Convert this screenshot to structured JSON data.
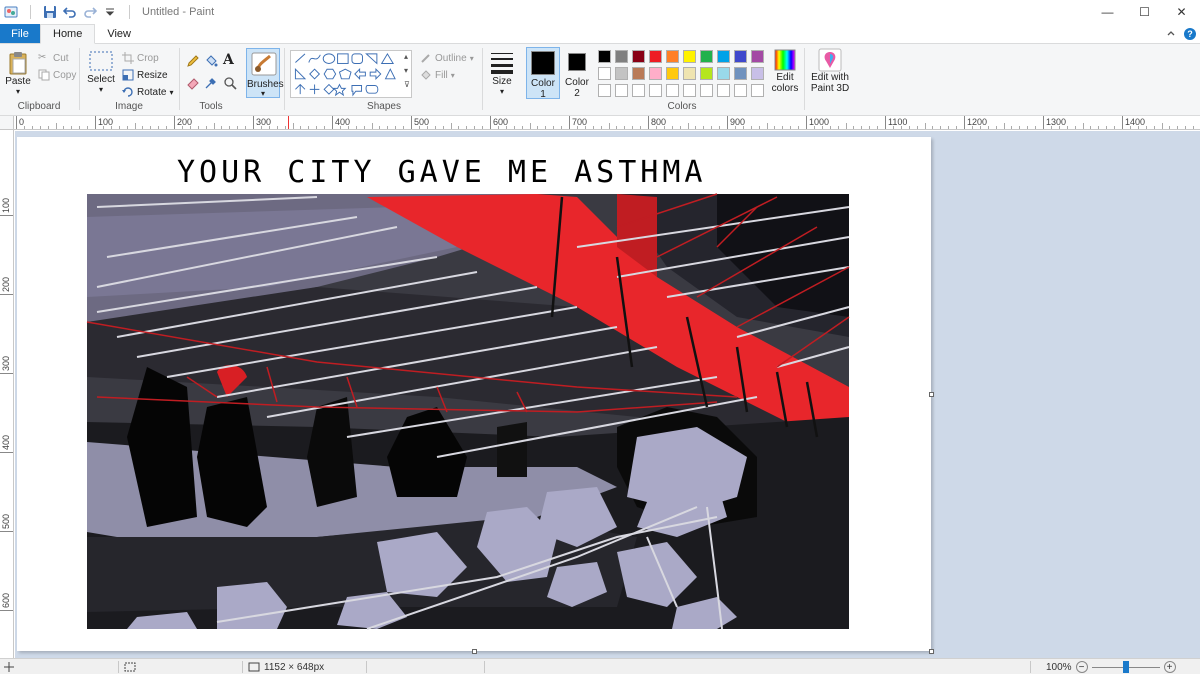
{
  "window": {
    "title": "Untitled - Paint",
    "controls": {
      "minimize": "—",
      "maximize": "☐",
      "close": "✕"
    }
  },
  "tabs": {
    "file": "File",
    "home": "Home",
    "view": "View"
  },
  "ribbon": {
    "clipboard": {
      "paste": "Paste",
      "cut": "Cut",
      "copy": "Copy",
      "label": "Clipboard"
    },
    "image": {
      "select": "Select",
      "crop": "Crop",
      "resize": "Resize",
      "rotate": "Rotate",
      "label": "Image"
    },
    "tools": {
      "label": "Tools",
      "text_tool": "A"
    },
    "brushes": {
      "label": "Brushes"
    },
    "shapes": {
      "outline": "Outline",
      "fill": "Fill",
      "label": "Shapes"
    },
    "size": {
      "label": "Size"
    },
    "color1": {
      "label": "Color",
      "num": "1",
      "value": "#000000"
    },
    "color2": {
      "label": "Color",
      "num": "2",
      "value": "#ffffff"
    },
    "colors": {
      "label": "Colors",
      "row1": [
        "#000000",
        "#7f7f7f",
        "#880015",
        "#ed1c24",
        "#ff7f27",
        "#fff200",
        "#22b14c",
        "#00a2e8",
        "#3f48cc",
        "#a349a4"
      ],
      "row2": [
        "#ffffff",
        "#c3c3c3",
        "#b97a57",
        "#ffaec9",
        "#ffc90e",
        "#efe4b0",
        "#b5e61d",
        "#99d9ea",
        "#7092be",
        "#c8bfe7"
      ],
      "row3": [
        "#ffffff",
        "#ffffff",
        "#ffffff",
        "#ffffff",
        "#ffffff",
        "#ffffff",
        "#ffffff",
        "#ffffff",
        "#ffffff",
        "#ffffff"
      ],
      "edit_line1": "Edit",
      "edit_line2": "colors",
      "paint3d_line1": "Edit with",
      "paint3d_line2": "Paint 3D"
    }
  },
  "ruler": {
    "h_labels": [
      "0",
      "100",
      "200",
      "300",
      "400",
      "500",
      "600",
      "700",
      "800",
      "900",
      "1000",
      "1100",
      "1200",
      "1300",
      "1400"
    ],
    "v_labels": [
      "100",
      "200",
      "300",
      "400",
      "500",
      "600"
    ]
  },
  "canvas": {
    "caption": "YOUR CITY GAVE ME ASTHMA"
  },
  "status": {
    "dimensions": "1152 × 648px",
    "zoom": "100%",
    "zoom_out": "−",
    "zoom_in": "+",
    "zoom_level": 0.5
  }
}
